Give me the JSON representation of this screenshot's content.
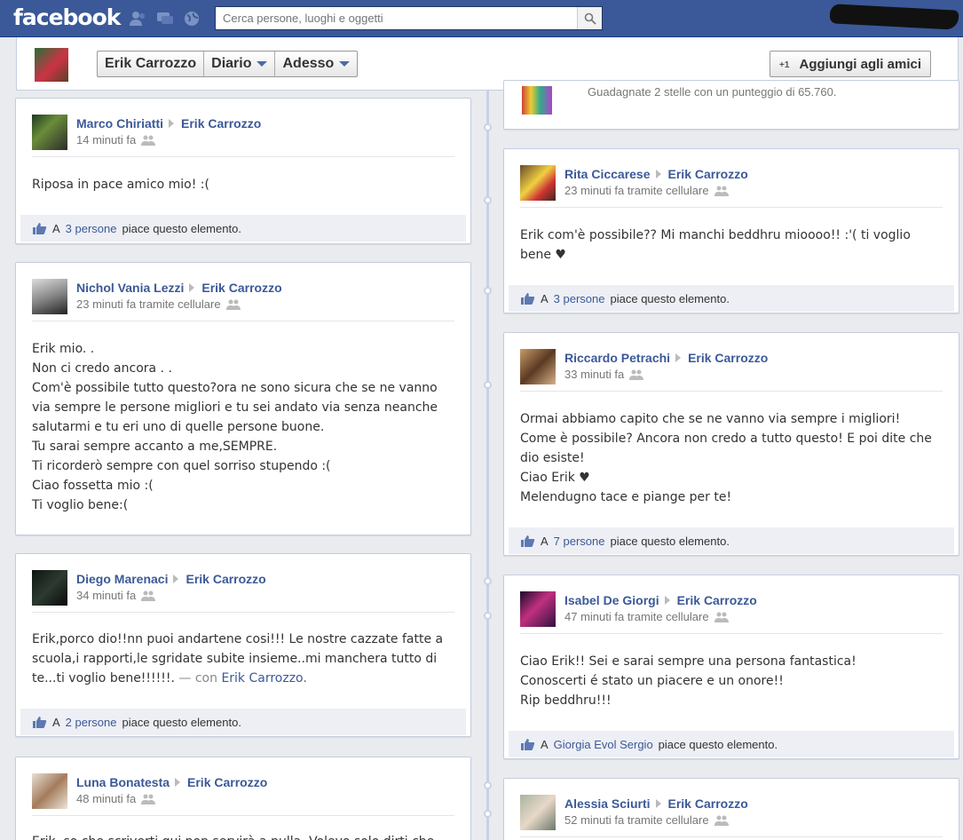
{
  "topbar": {
    "logo": "facebook",
    "search_placeholder": "Cerca persone, luoghi e oggetti"
  },
  "header": {
    "name": "Erik Carrozzo",
    "diary": "Diario",
    "now": "Adesso",
    "add_friend": "Aggiungi agli amici"
  },
  "colors": {
    "brand": "#3b5998",
    "link": "#3b5998",
    "like_bg": "#edeff4"
  },
  "game_post": {
    "text": "Guadagnate 2 stelle con un punteggio di 65.760."
  },
  "left_posts": [
    {
      "author": "Marco Chiriatti",
      "target": "Erik Carrozzo",
      "meta": "14 minuti fa",
      "lines": [
        "Riposa in pace amico mio! :("
      ],
      "likes_prefix": "A",
      "likes_link": "3 persone",
      "likes_suffix": "piace questo elemento."
    },
    {
      "author": "Nichol Vania Lezzi",
      "target": "Erik Carrozzo",
      "meta": "23 minuti fa tramite cellulare",
      "lines": [
        "Erik mio. .",
        "Non ci credo ancora . .",
        "Com'è possibile tutto questo?ora ne sono sicura che se ne vanno",
        "via sempre le persone migliori e tu sei andato via senza neanche",
        "salutarmi e tu eri uno di quelle persone buone.",
        "Tu sarai sempre accanto a me,SEMPRE.",
        "Ti ricorderò sempre con quel sorriso stupendo :(",
        "Ciao fossetta mio :(",
        "Ti voglio bene:("
      ]
    },
    {
      "author": "Diego Marenaci",
      "target": "Erik Carrozzo",
      "meta": "34 minuti fa",
      "lines": [
        "Erik,porco dio!!nn puoi andartene cosi!!! Le nostre cazzate fatte a",
        "scuola,i rapporti,le sgridate subite insieme..mi manchera tutto di",
        "te...ti voglio bene!!!!!!."
      ],
      "with_prefix": "— con",
      "with_name": "Erik Carrozzo.",
      "likes_prefix": "A",
      "likes_link": "2 persone",
      "likes_suffix": "piace questo elemento."
    },
    {
      "author": "Luna Bonatesta",
      "target": "Erik Carrozzo",
      "meta": "48 minuti fa",
      "lines": [
        "Erik, so che scriverti qui non servirà a nulla. Volevo solo dirti che"
      ]
    }
  ],
  "right_posts": [
    {
      "author": "Rita Ciccarese",
      "target": "Erik Carrozzo",
      "meta": "23 minuti fa tramite cellulare",
      "lines": [
        "Erik com'è possibile?? Mi manchi beddhru mioooo!! :'( ti voglio",
        "bene ♥"
      ],
      "likes_prefix": "A",
      "likes_link": "3 persone",
      "likes_suffix": "piace questo elemento."
    },
    {
      "author": "Riccardo Petrachi",
      "target": "Erik Carrozzo",
      "meta": "33 minuti fa",
      "lines": [
        "Ormai abbiamo capito che se ne vanno via sempre i migliori!",
        "Come è possibile? Ancora non credo a tutto questo! E poi dite che",
        "dio esiste!",
        "Ciao Erik ♥",
        "Melendugno tace e piange per te!"
      ],
      "likes_prefix": "A",
      "likes_link": "7 persone",
      "likes_suffix": "piace questo elemento."
    },
    {
      "author": "Isabel De Giorgi",
      "target": "Erik Carrozzo",
      "meta": "47 minuti fa tramite cellulare",
      "lines": [
        "Ciao Erik!! Sei e sarai sempre una persona fantastica!",
        "Conoscerti é stato un piacere e un onore!!",
        "Rip beddhru!!!"
      ],
      "likes_prefix": "A",
      "likes_link": "Giorgia Evol Sergio",
      "likes_suffix": "piace questo elemento."
    },
    {
      "author": "Alessia Sciurti",
      "target": "Erik Carrozzo",
      "meta": "52 minuti fa tramite cellulare",
      "lines": []
    }
  ]
}
